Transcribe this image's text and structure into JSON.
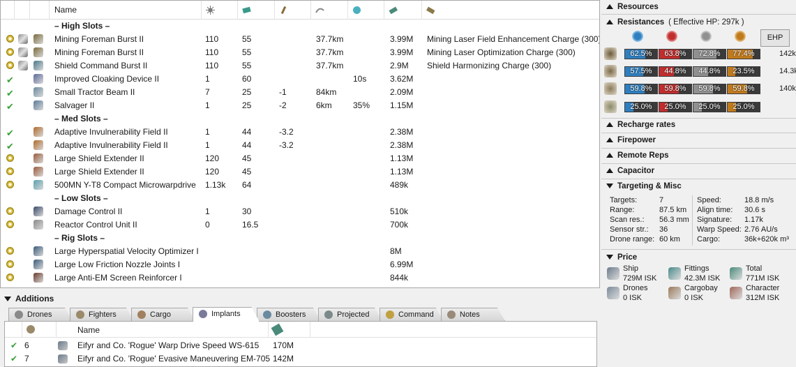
{
  "fitting": {
    "headers": {
      "name": "Name"
    },
    "rows": [
      {
        "kind": "section",
        "name": "– High Slots –"
      },
      {
        "kind": "module",
        "state": "online",
        "name": "Mining Foreman Burst II",
        "c1": "110",
        "c2": "55",
        "c3": "",
        "c4": "37.7km",
        "c5": "",
        "price": "3.99M",
        "charge": "Mining Laser Field Enhancement Charge (300)",
        "color": "#7a6a3a"
      },
      {
        "kind": "module",
        "state": "online",
        "name": "Mining Foreman Burst II",
        "c1": "110",
        "c2": "55",
        "c3": "",
        "c4": "37.7km",
        "c5": "",
        "price": "3.99M",
        "charge": "Mining Laser Optimization Charge (300)",
        "color": "#7a6a3a"
      },
      {
        "kind": "module",
        "state": "online",
        "name": "Shield Command Burst II",
        "c1": "110",
        "c2": "55",
        "c3": "",
        "c4": "37.7km",
        "c5": "",
        "price": "2.9M",
        "charge": "Shield Harmonizing Charge (300)",
        "color": "#4a7a8a"
      },
      {
        "kind": "module",
        "state": "check",
        "name": "Improved Cloaking Device II",
        "c1": "1",
        "c2": "60",
        "c3": "",
        "c4": "",
        "c5": "10s",
        "price": "3.62M",
        "charge": "",
        "color": "#5a6a9a"
      },
      {
        "kind": "module",
        "state": "check",
        "name": "Small Tractor Beam II",
        "c1": "7",
        "c2": "25",
        "c3": "-1",
        "c4": "84km",
        "c5": "",
        "price": "2.09M",
        "charge": "",
        "color": "#6a8aa0"
      },
      {
        "kind": "module",
        "state": "check",
        "name": "Salvager II",
        "c1": "1",
        "c2": "25",
        "c3": "-2",
        "c4": "6km",
        "c5": "35%",
        "price": "1.15M",
        "charge": "",
        "color": "#5a7a9a"
      },
      {
        "kind": "section",
        "name": "– Med Slots –"
      },
      {
        "kind": "module",
        "state": "check",
        "name": "Adaptive Invulnerability Field II",
        "c1": "1",
        "c2": "44",
        "c3": "-3.2",
        "c4": "",
        "c5": "",
        "price": "2.38M",
        "charge": "",
        "color": "#b06a2a"
      },
      {
        "kind": "module",
        "state": "check",
        "name": "Adaptive Invulnerability Field II",
        "c1": "1",
        "c2": "44",
        "c3": "-3.2",
        "c4": "",
        "c5": "",
        "price": "2.38M",
        "charge": "",
        "color": "#b06a2a"
      },
      {
        "kind": "module",
        "state": "online",
        "name": "Large Shield Extender II",
        "c1": "120",
        "c2": "45",
        "c3": "",
        "c4": "",
        "c5": "",
        "price": "1.13M",
        "charge": "",
        "color": "#9a5a3a"
      },
      {
        "kind": "module",
        "state": "online",
        "name": "Large Shield Extender II",
        "c1": "120",
        "c2": "45",
        "c3": "",
        "c4": "",
        "c5": "",
        "price": "1.13M",
        "charge": "",
        "color": "#9a5a3a"
      },
      {
        "kind": "module",
        "state": "online",
        "name": "500MN Y-T8 Compact Microwarpdrive",
        "c1": "1.13k",
        "c2": "64",
        "c3": "",
        "c4": "",
        "c5": "",
        "price": "489k",
        "charge": "",
        "color": "#5aa0b0"
      },
      {
        "kind": "section",
        "name": "– Low Slots –"
      },
      {
        "kind": "module",
        "state": "online",
        "name": "Damage Control II",
        "c1": "1",
        "c2": "30",
        "c3": "",
        "c4": "",
        "c5": "",
        "price": "510k",
        "charge": "",
        "color": "#3a4a6a"
      },
      {
        "kind": "module",
        "state": "online",
        "name": "Reactor Control Unit II",
        "c1": "0",
        "c2": "16.5",
        "c3": "",
        "c4": "",
        "c5": "",
        "price": "700k",
        "charge": "",
        "color": "#8a8a8a"
      },
      {
        "kind": "section",
        "name": "– Rig Slots –"
      },
      {
        "kind": "module",
        "state": "online",
        "name": "Large Hyperspatial Velocity Optimizer I",
        "c1": "",
        "c2": "",
        "c3": "",
        "c4": "",
        "c5": "",
        "price": "8M",
        "charge": "",
        "color": "#3a5a7a"
      },
      {
        "kind": "module",
        "state": "online",
        "name": "Large Low Friction Nozzle Joints I",
        "c1": "",
        "c2": "",
        "c3": "",
        "c4": "",
        "c5": "",
        "price": "6.99M",
        "charge": "",
        "color": "#3a5a7a"
      },
      {
        "kind": "module",
        "state": "online",
        "name": "Large Anti-EM Screen Reinforcer I",
        "c1": "",
        "c2": "",
        "c3": "",
        "c4": "",
        "c5": "",
        "price": "844k",
        "charge": "",
        "color": "#6a3a2a"
      }
    ]
  },
  "additions": {
    "title": "Additions",
    "tabs": [
      "Drones",
      "Fighters",
      "Cargo",
      "Implants",
      "Boosters",
      "Projected",
      "Command",
      "Notes"
    ],
    "active_tab": "Implants",
    "implants_header": {
      "name": "Name"
    },
    "implants": [
      {
        "slot": "6",
        "name": "Eifyr and Co. 'Rogue' Warp Drive Speed WS-615",
        "price": "170M"
      },
      {
        "slot": "7",
        "name": "Eifyr and Co. 'Rogue' Evasive Maneuvering EM-705",
        "price": "142M"
      }
    ]
  },
  "stats": {
    "resources": "Resources",
    "resistances": "Resistances",
    "effective_hp": "( Effective HP: 297k )",
    "ehp_button": "EHP",
    "resist_rows": [
      {
        "type": "shield",
        "vals": [
          "62.5%",
          "63.8%",
          "72.8%",
          "77.4%"
        ],
        "fills": [
          0.625,
          0.638,
          0.728,
          0.774
        ],
        "hp": "142k"
      },
      {
        "type": "armor",
        "vals": [
          "57.5%",
          "44.8%",
          "44.8%",
          "23.5%"
        ],
        "fills": [
          0.575,
          0.448,
          0.448,
          0.235
        ],
        "hp": "14.3k"
      },
      {
        "type": "hull",
        "vals": [
          "59.8%",
          "59.8%",
          "59.8%",
          "59.8%"
        ],
        "fills": [
          0.598,
          0.598,
          0.598,
          0.598
        ],
        "hp": "140k"
      },
      {
        "type": "damage-pattern",
        "vals": [
          "25.0%",
          "25.0%",
          "25.0%",
          "25.0%"
        ],
        "fills": [
          0.25,
          0.25,
          0.25,
          0.25
        ],
        "hp": ""
      }
    ],
    "damage_colors": [
      "#2f7fc0",
      "#c02e2e",
      "#909090",
      "#c07a1e"
    ],
    "recharge": "Recharge rates",
    "firepower": "Firepower",
    "remote_reps": "Remote Reps",
    "capacitor": "Capacitor",
    "targeting": "Targeting & Misc",
    "targeting_left": [
      {
        "label": "Targets:",
        "value": "7"
      },
      {
        "label": "Range:",
        "value": "87.5 km"
      },
      {
        "label": "Scan res.:",
        "value": "56.3 mm"
      },
      {
        "label": "Sensor str.:",
        "value": "36"
      },
      {
        "label": "Drone range:",
        "value": "60 km"
      }
    ],
    "targeting_right": [
      {
        "label": "Speed:",
        "value": "18.8 m/s"
      },
      {
        "label": "Align time:",
        "value": "30.6 s"
      },
      {
        "label": "Signature:",
        "value": "1.17k"
      },
      {
        "label": "Warp Speed:",
        "value": "2.76 AU/s"
      },
      {
        "label": "Cargo:",
        "value": "36k+620k m³"
      }
    ],
    "price": "Price",
    "prices": [
      {
        "label": "Ship",
        "value": "729M ISK"
      },
      {
        "label": "Fittings",
        "value": "42.3M ISK"
      },
      {
        "label": "Total",
        "value": "771M ISK"
      },
      {
        "label": "Drones",
        "value": "0 ISK"
      },
      {
        "label": "Cargobay",
        "value": "0 ISK"
      },
      {
        "label": "Character",
        "value": "312M ISK"
      }
    ]
  }
}
